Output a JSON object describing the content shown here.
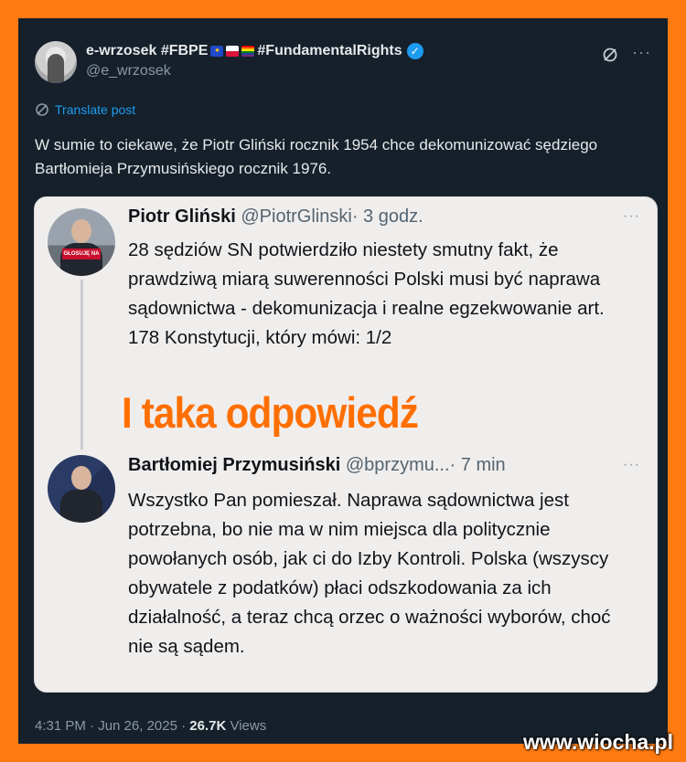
{
  "post": {
    "author_name_prefix": "e-wrzosek #FBPE",
    "author_name_suffix": "#FundamentalRights",
    "handle": "@e_wrzosek",
    "translate_label": "Translate post",
    "text": "W sumie to ciekawe, że Piotr Gliński rocznik 1954 chce dekomunizować sędziego Bartłomieja Przymusińskiego rocznik 1976.",
    "more_label": "···",
    "icons": [
      "grok-icon",
      "more-icon",
      "verified-badge-icon",
      "eu-flag",
      "pl-flag",
      "rainbow-flag"
    ],
    "colors": {
      "accent": "#1d9bf0",
      "background": "#15202b",
      "frame": "#ff7a10"
    }
  },
  "quote": {
    "tweet1": {
      "name": "Piotr Gliński",
      "handle": "@PiotrGlinski",
      "time": "· 3 godz.",
      "text": "28 sędziów SN potwierdziło niestety smutny fakt, że prawdziwą miarą suwerenności Polski musi być naprawa sądownictwa - dekomunizacja i realne egzekwowanie art. 178 Konstytucji, który mówi: 1/2",
      "avatar_sign": "GŁOSUJĘ NA KAROLA NAWROCKIEGO"
    },
    "overlay_text": "I taka odpowiedź",
    "tweet2": {
      "name": "Bartłomiej Przymusiński",
      "handle": "@bprzymu...",
      "time": "· 7 min",
      "text": "Wszystko Pan pomieszał. Naprawa sądownictwa jest potrzebna, bo nie ma w nim miejsca dla politycznie powołanych osób, jak ci do Izby Kontroli. Polska (wszyscy obywatele z podatków) płaci odszkodowania za ich działalność, a teraz chcą orzec o ważności wyborów, choć nie są sądem."
    },
    "more_label": "···"
  },
  "footer": {
    "time": "4:31 PM · Jun 26, 2025 ·",
    "views_count": "26.7K",
    "views_label": "Views"
  },
  "watermark": "www.wiocha.pl"
}
